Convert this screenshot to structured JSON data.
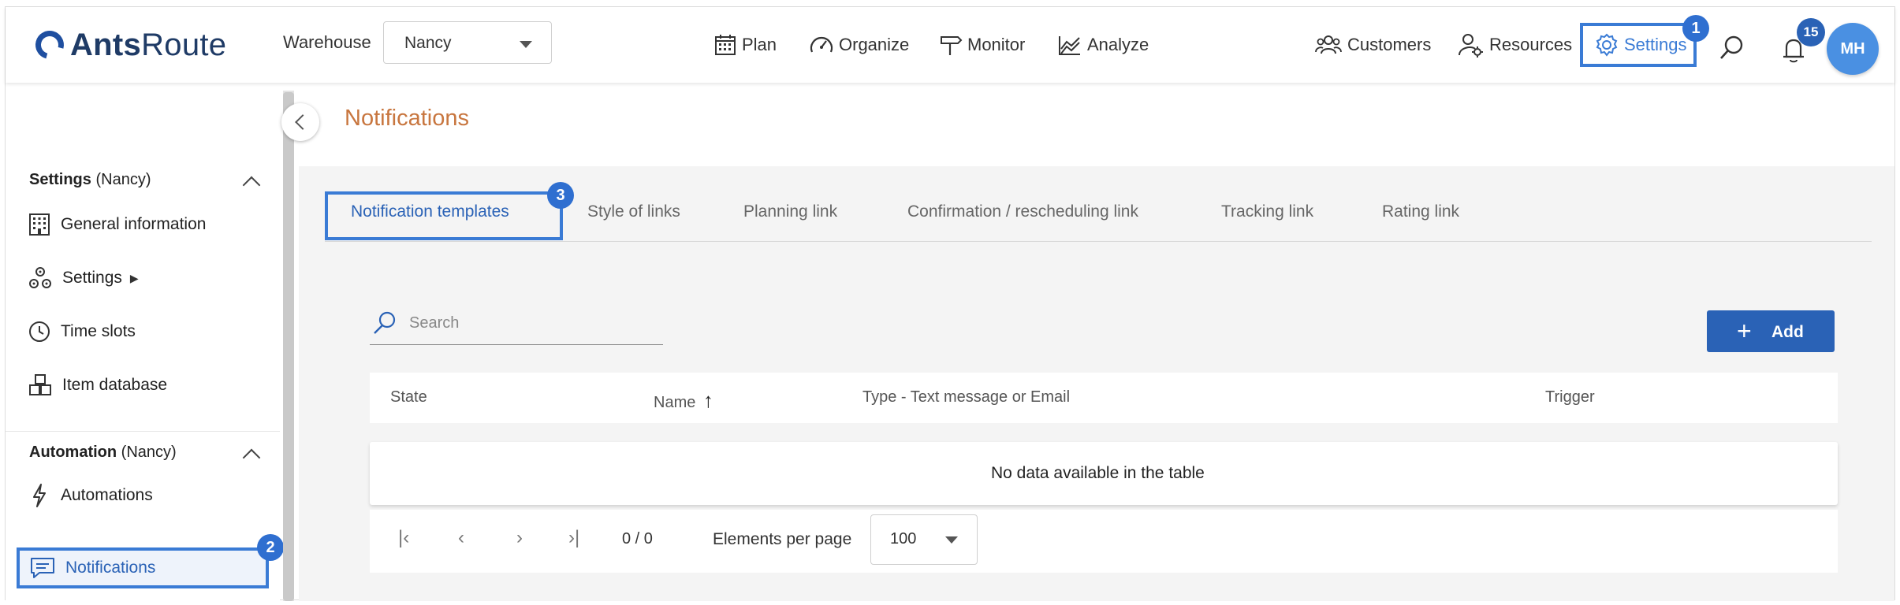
{
  "brand": {
    "name_bold": "Ants",
    "name_rest": "Route"
  },
  "header": {
    "warehouse_label": "Warehouse",
    "warehouse_value": "Nancy",
    "nav": {
      "plan": "Plan",
      "organize": "Organize",
      "monitor": "Monitor",
      "analyze": "Analyze",
      "customers": "Customers",
      "resources": "Resources",
      "settings": "Settings"
    },
    "notifications_count": "15",
    "avatar_initials": "MH"
  },
  "annotations": {
    "one": "1",
    "two": "2",
    "three": "3"
  },
  "sidebar": {
    "settings_section": {
      "title": "Settings",
      "context": "(Nancy)"
    },
    "settings_items": {
      "general": "General information",
      "settings": "Settings",
      "timeslots": "Time slots",
      "items": "Item database"
    },
    "settings_arrow": "▶",
    "automation_section": {
      "title": "Automation",
      "context": "(Nancy)"
    },
    "automation_items": {
      "automations": "Automations",
      "notifications": "Notifications"
    }
  },
  "page": {
    "title": "Notifications"
  },
  "tabs": {
    "t1": "Notification templates",
    "t2": "Style of links",
    "t3": "Planning link",
    "t4": "Confirmation / rescheduling link",
    "t5": "Tracking link",
    "t6": "Rating link"
  },
  "search": {
    "placeholder": "Search"
  },
  "actions": {
    "add": "Add",
    "add_symbol": "+"
  },
  "table": {
    "columns": {
      "state": "State",
      "name": "Name",
      "type": "Type - Text message or Email",
      "trigger": "Trigger"
    },
    "sort_arrow": "↑",
    "empty": "No data available in the table"
  },
  "pagination": {
    "first": "|‹",
    "prev": "‹",
    "next": "›",
    "last": "›|",
    "range": "0 / 0",
    "per_page_label": "Elements per page",
    "per_page_value": "100"
  },
  "colors": {
    "accent": "#2a62b6",
    "annotation": "#3a7bd5",
    "title": "#c8763f"
  }
}
